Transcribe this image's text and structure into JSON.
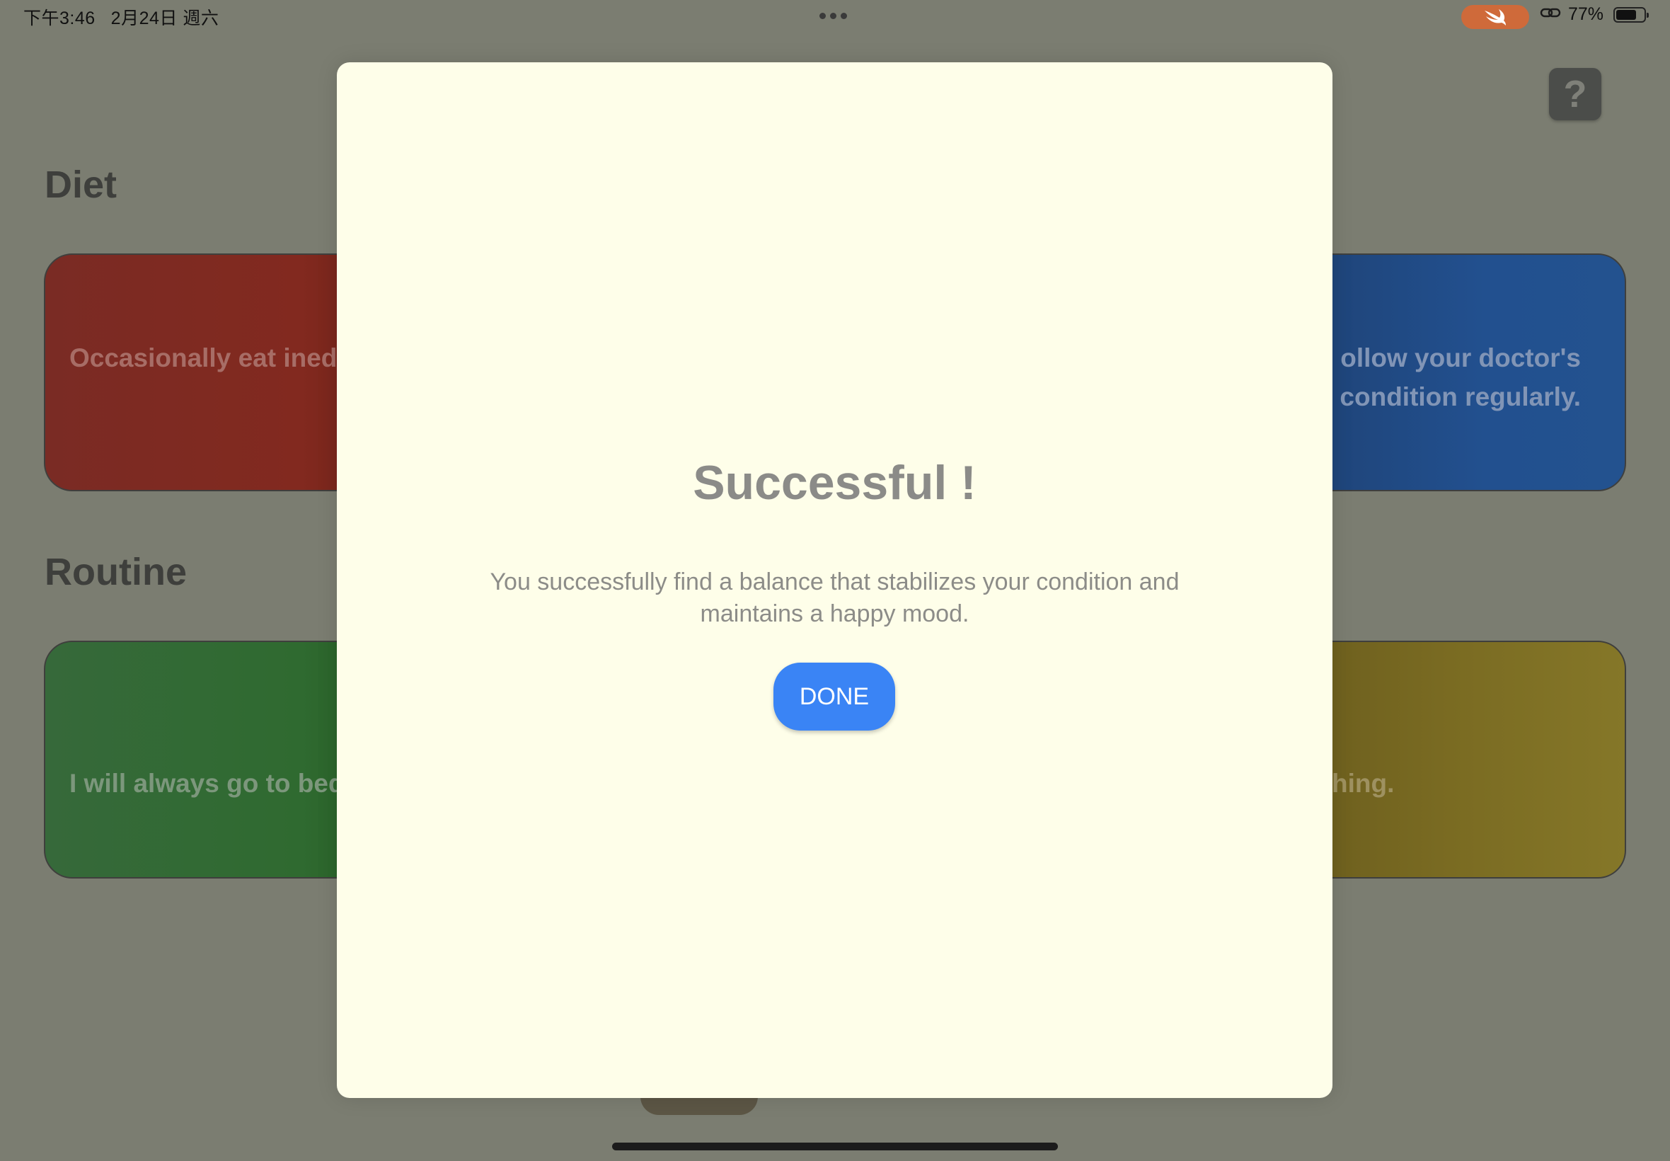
{
  "status_bar": {
    "time": "下午3:46",
    "date": "2月24日 週六",
    "battery_percent": "77%",
    "battery_level": 0.77
  },
  "background": {
    "help_label": "?",
    "sections": [
      {
        "title": "Diet",
        "cards": [
          {
            "text": "Occasionally eat inedi",
            "color": "#82291f"
          },
          {
            "text": "ollow your doctor's\n condition regularly.",
            "color": "#22508f"
          }
        ]
      },
      {
        "title": "Routine",
        "cards": [
          {
            "text": "I will always go to bed",
            "color": "#2f6a30"
          },
          {
            "text": "hing.",
            "color": "#7a6b22"
          }
        ]
      }
    ]
  },
  "modal": {
    "title": "Successful !",
    "message": "You successfully find a balance that stabilizes your condition and maintains a happy mood.",
    "done_label": "DONE",
    "background_color": "#fefee9",
    "button_color": "#3a84f5"
  },
  "icons": {
    "swift": "swift-icon",
    "link": "link-icon",
    "battery": "battery-icon",
    "more": "more-dots-icon"
  }
}
